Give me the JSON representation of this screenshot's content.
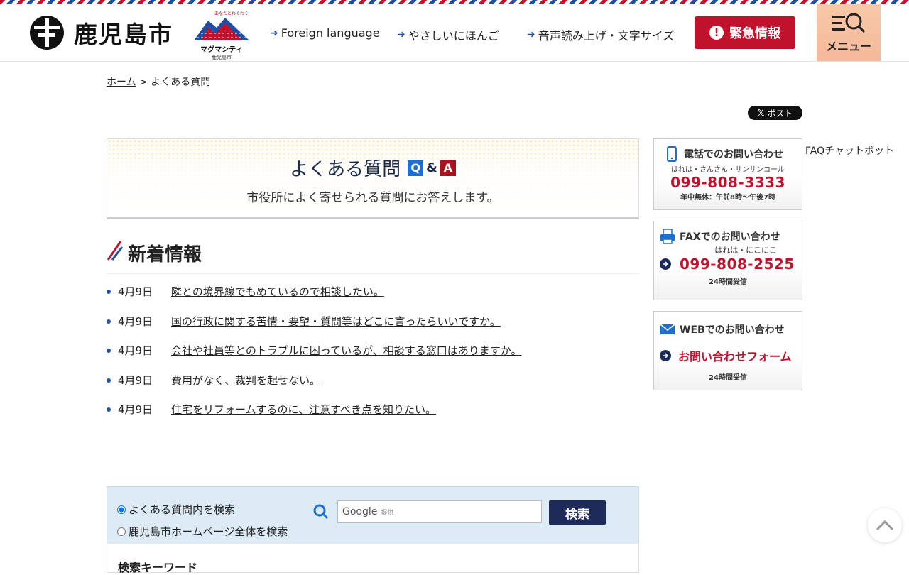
{
  "header": {
    "city_name": "鹿児島市",
    "magma_label": "マグマシティ",
    "magma_sub": "鹿児島市",
    "magma_top": "あなたとわくわく",
    "nav": [
      {
        "label": "Foreign language"
      },
      {
        "label": "やさしいにほんご"
      },
      {
        "label": "音声読み上げ・文字サイズ"
      }
    ],
    "emergency_label": "緊急情報",
    "menu_label": "メニュー"
  },
  "breadcrumb": {
    "home": "ホーム",
    "separator": ">",
    "current": "よくある質問"
  },
  "share": {
    "x_post": "ポスト"
  },
  "faq": {
    "title": "よくある質問",
    "q": "Q",
    "amp": "&",
    "a": "A",
    "subtitle": "市役所によく寄せられる質問にお答えします。"
  },
  "news": {
    "heading": "新着情報",
    "items": [
      {
        "date": "4月9日",
        "title": "隣との境界線でもめているので相談したい。"
      },
      {
        "date": "4月9日",
        "title": "国の行政に関する苦情・要望・質問等はどこに言ったらいいですか。"
      },
      {
        "date": "4月9日",
        "title": "会社や社員等とのトラブルに困っているが、相談する窓口はありますか。"
      },
      {
        "date": "4月9日",
        "title": "費用がなく、裁判を起せない。"
      },
      {
        "date": "4月9日",
        "title": "住宅をリフォームするのに、注意すべき点を知りたい。"
      }
    ]
  },
  "contacts": {
    "phone": {
      "heading": "電話でのお問い合わせ",
      "nickname": "はれは・さんさん・サンサンコール",
      "number": "099-808-3333",
      "note": "年中無休：午前8時～午後7時"
    },
    "fax": {
      "heading": "FAXでのお問い合わせ",
      "nickname": "はれは・にこにこ",
      "number": "099-808-2525",
      "note": "24時間受信"
    },
    "web": {
      "heading": "WEBでのお問い合わせ",
      "link": "お問い合わせフォーム",
      "note": "24時間受信"
    }
  },
  "faq_chatbot": "FAQチャットボット",
  "search": {
    "option_faq": "よくある質問内を検索",
    "option_site": "鹿児島市ホームページ全体を検索",
    "placeholder_brand": "Google",
    "placeholder_by": "提供",
    "button": "検索",
    "keyword_heading": "検索キーワード"
  },
  "colors": {
    "accent_red": "#c0122c",
    "accent_blue": "#1f4ea3",
    "navy": "#1e2a5a",
    "menu_bg": "#f5b89a"
  }
}
